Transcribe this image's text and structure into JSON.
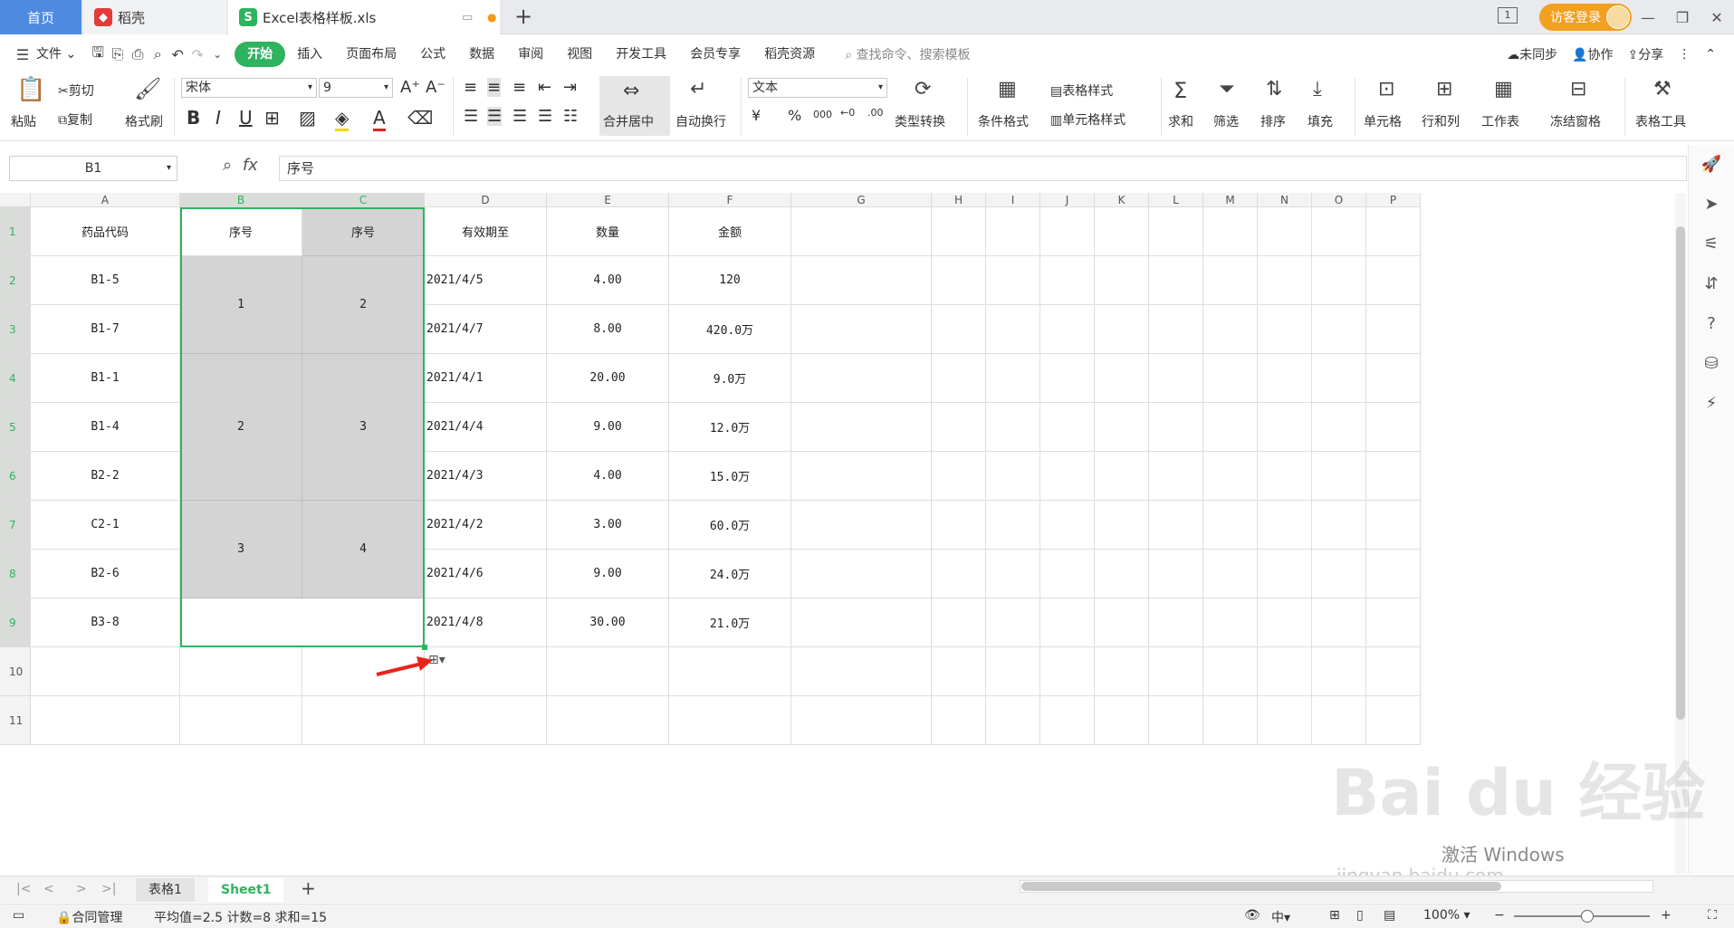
{
  "titlebar": {
    "tabs": [
      {
        "label": "首页"
      },
      {
        "label": "稻壳"
      },
      {
        "label": "Excel表格样板.xls"
      }
    ],
    "badge": "1",
    "visitor_label": "访客登录"
  },
  "menu": {
    "file_label": "文件",
    "items": [
      "开始",
      "插入",
      "页面布局",
      "公式",
      "数据",
      "审阅",
      "视图",
      "开发工具",
      "会员专享",
      "稻壳资源"
    ],
    "search_placeholder": "查找命令、搜索模板",
    "sync_label": "未同步",
    "collab_label": "协作",
    "share_label": "分享"
  },
  "ribbon": {
    "paste": "粘贴",
    "cut": "剪切",
    "copy": "复制",
    "format_painter": "格式刷",
    "font_name": "宋体",
    "font_size": "9",
    "merge_center": "合并居中",
    "wrap": "自动换行",
    "number_format": "文本",
    "type_convert": "类型转换",
    "cond_format": "条件格式",
    "table_style": "表格样式",
    "cell_style": "单元格样式",
    "sum": "求和",
    "filter": "筛选",
    "sort": "排序",
    "fill": "填充",
    "cell": "单元格",
    "rowcol": "行和列",
    "worksheet": "工作表",
    "freeze": "冻结窗格",
    "table_tools": "表格工具"
  },
  "formula_bar": {
    "name_box": "B1",
    "fx": "fx",
    "content": "序号"
  },
  "grid": {
    "columns": [
      "A",
      "B",
      "C",
      "D",
      "E",
      "F",
      "G",
      "H",
      "I",
      "J",
      "K",
      "L",
      "M",
      "N",
      "O",
      "P"
    ],
    "rows": [
      "1",
      "2",
      "3",
      "4",
      "5",
      "6",
      "7",
      "8",
      "9",
      "10",
      "11"
    ],
    "header": [
      "药品代码",
      "序号",
      "序号",
      "有效期至",
      "数量",
      "金额"
    ],
    "col_a": [
      "B1-5",
      "B1-7",
      "B1-1",
      "B1-4",
      "B2-2",
      "C2-1",
      "B2-6",
      "B3-8"
    ],
    "col_b_merged": [
      "1",
      "2",
      "3"
    ],
    "col_c_merged": [
      "2",
      "3",
      "4"
    ],
    "col_d": [
      "2021/4/5",
      "2021/4/7",
      "2021/4/1",
      "2021/4/4",
      "2021/4/3",
      "2021/4/2",
      "2021/4/6",
      "2021/4/8"
    ],
    "col_e": [
      "4.00",
      "8.00",
      "20.00",
      "9.00",
      "4.00",
      "3.00",
      "9.00",
      "30.00"
    ],
    "col_f": [
      "120",
      "420.0万",
      "9.0万",
      "12.0万",
      "15.0万",
      "60.0万",
      "24.0万",
      "21.0万"
    ]
  },
  "sheets": {
    "tabs": [
      "表格1",
      "Sheet1"
    ],
    "active": "Sheet1"
  },
  "status": {
    "contract": "合同管理",
    "summary": "平均值=2.5  计数=8  求和=15",
    "zoom": "100%"
  },
  "watermark": {
    "main": "Bai du 经验",
    "sub": "jingyan.baidu.com",
    "activate": "激活 Windows"
  },
  "colors": {
    "accent_green": "#2eb35f",
    "home_tab": "#4d8ae0",
    "visitor": "#f2a020"
  }
}
